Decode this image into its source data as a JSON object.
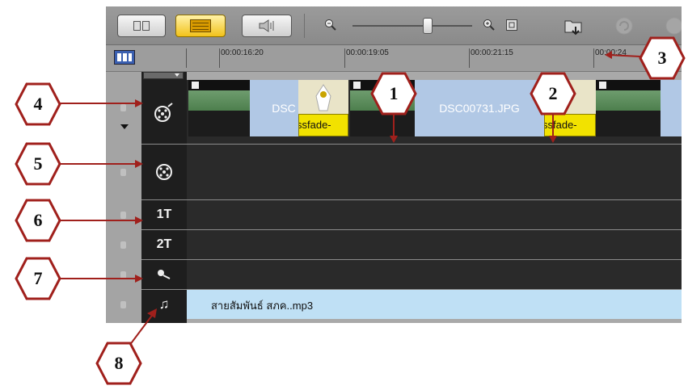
{
  "toolbar": {
    "view_buttons": [
      {
        "icon": "storyboard-view-icon"
      },
      {
        "icon": "timeline-view-icon",
        "active": true
      },
      {
        "icon": "audio-view-icon"
      }
    ],
    "zoom_out_icon": "zoom-out-icon",
    "zoom_in_icon": "zoom-in-icon",
    "fit_icon": "fit-to-window-icon",
    "import_icon": "insert-media-icon",
    "undo_icon": "undo-icon",
    "redo_icon": "redo-icon"
  },
  "ruler": {
    "timecodes": [
      "00:00:16:20",
      "00:00:19:05",
      "00:00:21:15",
      "00:00:24"
    ],
    "track_manager_icon": "track-manager-icon"
  },
  "tracks": {
    "video": {
      "icon": "video-track-icon",
      "clips": [
        {
          "type": "photo",
          "label": ""
        },
        {
          "type": "image",
          "label": "DSC"
        },
        {
          "type": "transition",
          "label": "ssfade-"
        },
        {
          "type": "photo",
          "label": ""
        },
        {
          "type": "image",
          "label": "DSC00731.JPG"
        },
        {
          "type": "transition",
          "label": "ssfade-"
        },
        {
          "type": "photo",
          "label": ""
        }
      ]
    },
    "overlay": {
      "icon": "overlay-track-icon"
    },
    "title1": {
      "label": "1T"
    },
    "title2": {
      "label": "2T"
    },
    "voice": {
      "icon": "voice-track-icon"
    },
    "music": {
      "icon": "music-track-icon",
      "clip_label": "สายสัมพันธ์ สภค..mp3"
    }
  },
  "callouts": [
    "1",
    "2",
    "3",
    "4",
    "5",
    "6",
    "7",
    "8"
  ],
  "colors": {
    "callout_arrow": "#a0201c",
    "active_button": "#f2c21a",
    "transition_clip": "#f2e200",
    "audio_lane": "#bfe0f5",
    "track_background": "#2a2a2a"
  }
}
